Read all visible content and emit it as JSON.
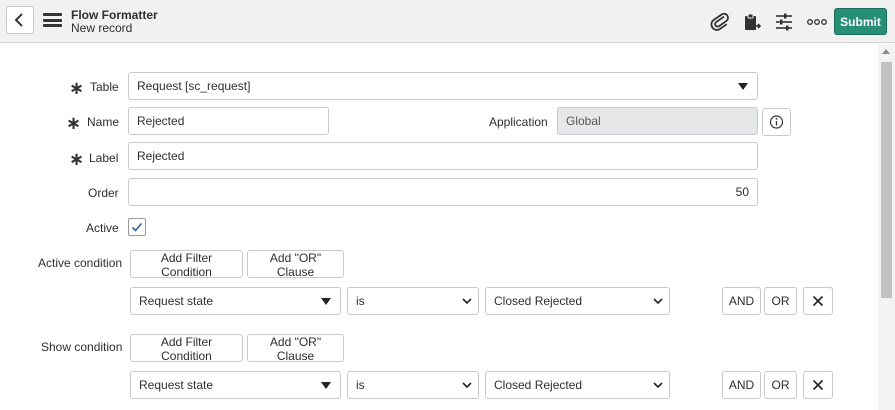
{
  "header": {
    "title": "Flow Formatter",
    "subtitle": "New record",
    "submit_label": "Submit",
    "icons": [
      "back-icon",
      "menu-icon",
      "paperclip-icon",
      "clipboard-icon",
      "sliders-icon",
      "more-icon"
    ]
  },
  "form": {
    "table": {
      "label": "Table",
      "value": "Request [sc_request]"
    },
    "name": {
      "label": "Name",
      "value": "Rejected"
    },
    "application": {
      "label": "Application",
      "value": "Global"
    },
    "label_field": {
      "label": "Label",
      "value": "Rejected"
    },
    "order": {
      "label": "Order",
      "value": "50"
    },
    "active": {
      "label": "Active",
      "checked": true
    },
    "required_mark": "∗"
  },
  "active_condition": {
    "label": "Active condition",
    "add_filter": "Add Filter Condition",
    "add_or": "Add \"OR\" Clause",
    "field": "Request state",
    "operator": "is",
    "value": "Closed Rejected",
    "and_label": "AND",
    "or_label": "OR"
  },
  "show_condition": {
    "label": "Show condition",
    "add_filter": "Add Filter Condition",
    "add_or": "Add \"OR\" Clause",
    "field": "Request state",
    "operator": "is",
    "value": "Closed Rejected",
    "and_label": "AND",
    "or_label": "OR"
  },
  "colors": {
    "accent": "#278e77",
    "header_bg": "#f1f1f1",
    "readonly_bg": "#e5e7e8"
  }
}
